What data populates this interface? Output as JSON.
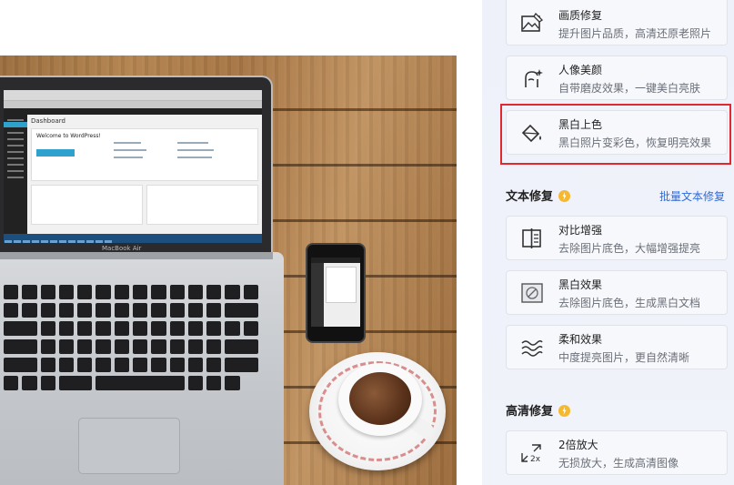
{
  "panel": {
    "top_cards": [
      {
        "title": "画质修复",
        "desc": "提升图片品质，高清还原老照片",
        "icon": "image-edit-icon"
      },
      {
        "title": "人像美颜",
        "desc": "自带磨皮效果，一键美白亮肤",
        "icon": "face-sparkle-icon"
      },
      {
        "title": "黑白上色",
        "desc": "黑白照片变彩色，恢复明亮效果",
        "icon": "paint-bucket-icon",
        "selected": true
      }
    ],
    "text_section": {
      "title": "文本修复",
      "link": "批量文本修复",
      "badge_icon": "lightning-badge-icon",
      "cards": [
        {
          "title": "对比增强",
          "desc": "去除图片底色，大幅增强提亮",
          "icon": "contrast-compare-icon"
        },
        {
          "title": "黑白效果",
          "desc": "去除图片底色，生成黑白文档",
          "icon": "bw-document-icon"
        },
        {
          "title": "柔和效果",
          "desc": "中度提亮图片，更自然清晰",
          "icon": "wave-lines-icon"
        }
      ]
    },
    "hd_section": {
      "title": "高清修复",
      "badge_icon": "lightning-badge-icon",
      "cards": [
        {
          "title": "2倍放大",
          "desc": "无损放大，生成高清图像",
          "icon": "expand-2x-icon",
          "icon_text": "2x"
        }
      ]
    },
    "highlight_color": "#e0282e",
    "link_color": "#2f6bd8"
  },
  "photo": {
    "laptop_brand": "MacBook Air",
    "screen_title": "Dashboard",
    "screen_welcome": "Welcome to WordPress!"
  }
}
